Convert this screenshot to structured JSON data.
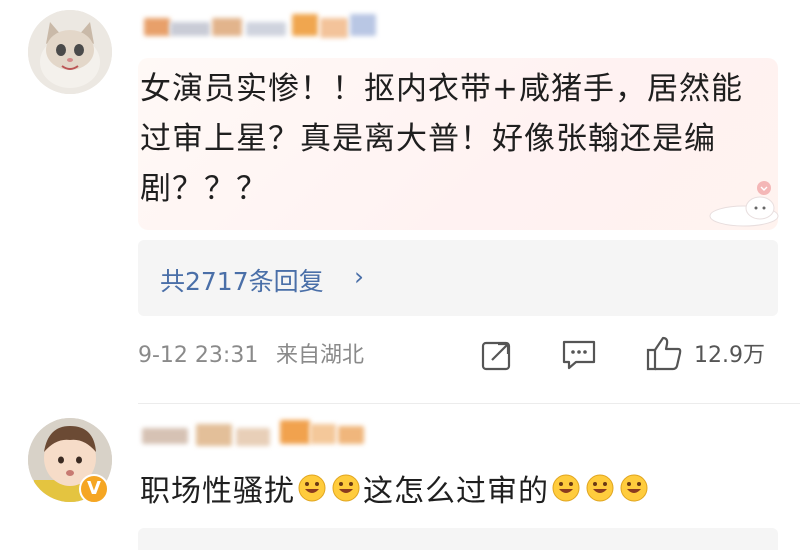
{
  "comments": [
    {
      "username_obscured": true,
      "text": "女演员实惨！！抠内衣带+咸猪手，居然能过审上星？真是离大普！好像张翰还是编剧？？？",
      "replies_label": "共2717条回复",
      "time": "9-12 23:31",
      "location": "来自湖北",
      "like_count": "12.9万",
      "icons": [
        "share-icon",
        "comment-icon",
        "like-icon"
      ]
    },
    {
      "username_obscured": true,
      "verified": "V",
      "text_a": "职场性骚扰",
      "text_b": "这怎么过审的",
      "emoji_name": "grinning-face-emoji"
    }
  ],
  "colors": {
    "link": "#4a6fa8",
    "meta": "#8a8a8a",
    "badge": "#f5a623"
  }
}
